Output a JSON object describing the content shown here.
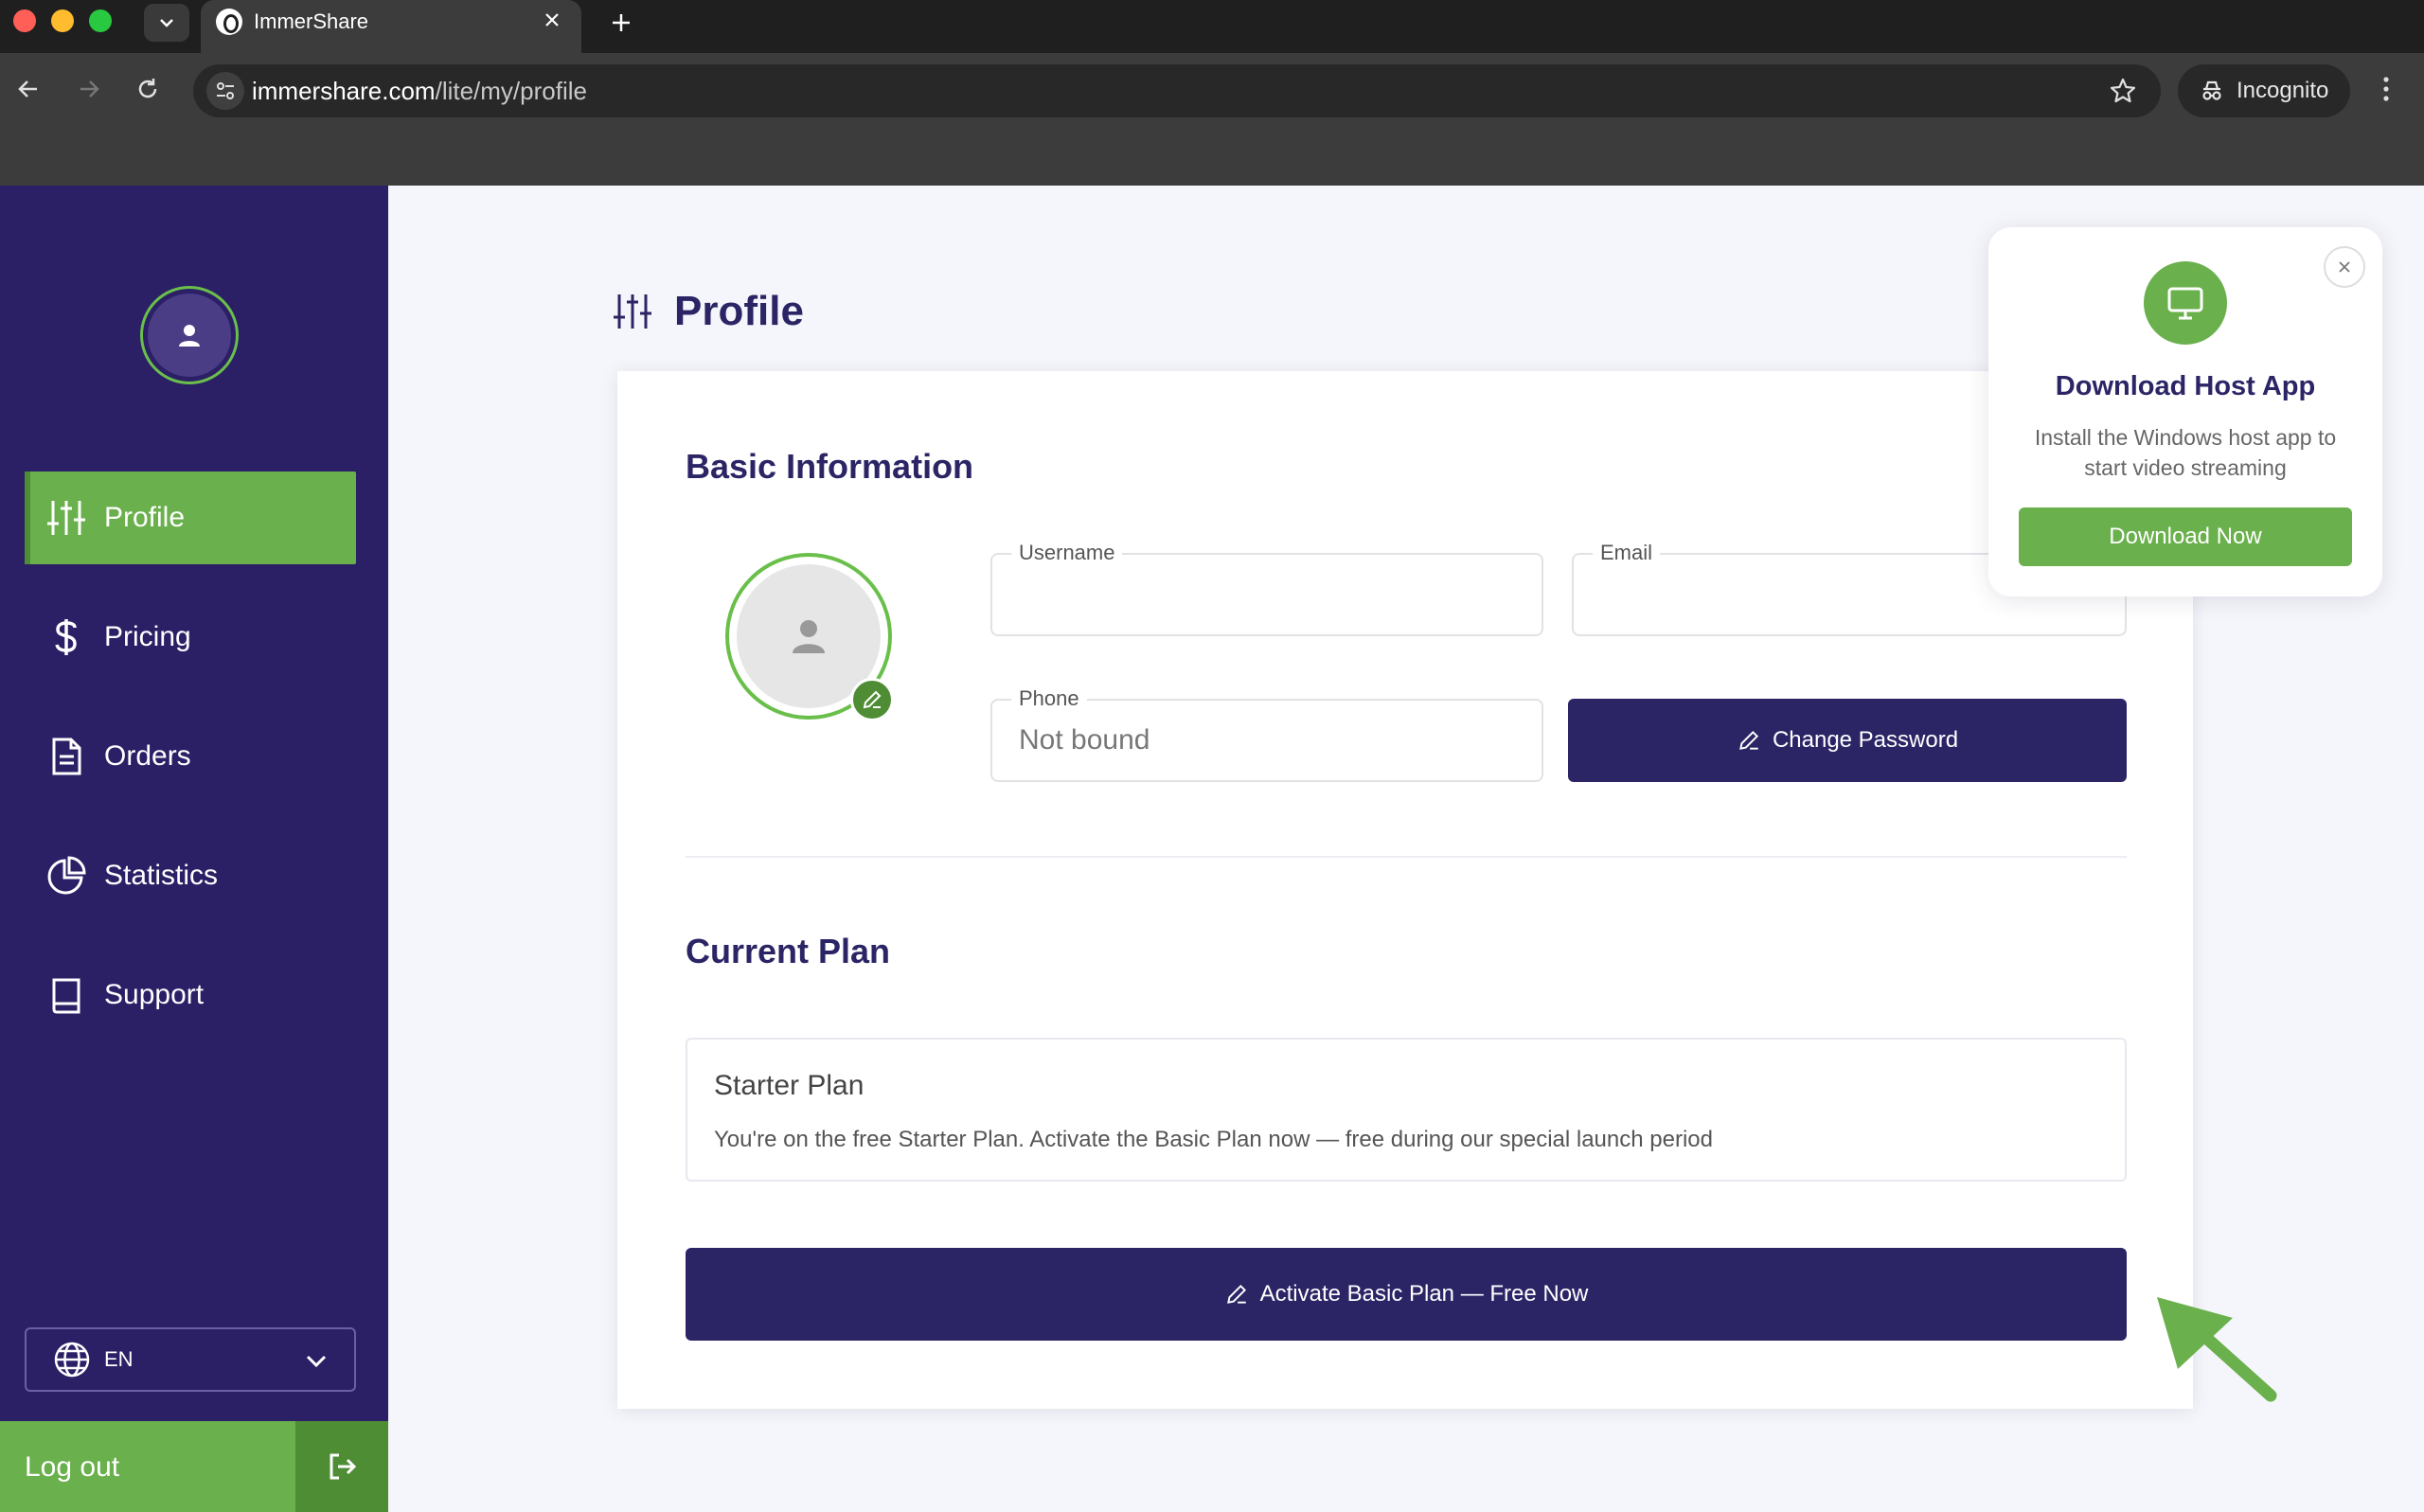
{
  "browser": {
    "tab_title": "ImmerShare",
    "url_host": "immershare.com",
    "url_path": "/lite/my/profile",
    "incognito_label": "Incognito"
  },
  "sidebar": {
    "items": [
      {
        "label": "Profile",
        "icon": "sliders-icon",
        "active": true
      },
      {
        "label": "Pricing",
        "icon": "dollar-icon",
        "active": false
      },
      {
        "label": "Orders",
        "icon": "document-icon",
        "active": false
      },
      {
        "label": "Statistics",
        "icon": "pie-chart-icon",
        "active": false
      },
      {
        "label": "Support",
        "icon": "book-icon",
        "active": false
      }
    ],
    "language": "EN",
    "logout_label": "Log out"
  },
  "main": {
    "page_title": "Profile",
    "basic_info_title": "Basic Information",
    "username": {
      "label": "Username",
      "value": ""
    },
    "email": {
      "label": "Email",
      "value": ""
    },
    "phone": {
      "label": "Phone",
      "placeholder": "Not bound"
    },
    "change_password_label": "Change Password",
    "current_plan_title": "Current Plan",
    "plan_name": "Starter Plan",
    "plan_description": "You're on the free Starter Plan. Activate the Basic Plan now — free during our special launch period",
    "activate_label": "Activate Basic Plan — Free Now"
  },
  "popup": {
    "title": "Download Host App",
    "description": "Install the Windows host app to start video streaming",
    "button_label": "Download Now"
  },
  "colors": {
    "sidebar_bg": "#2b1f66",
    "accent_green": "#6ab04c",
    "primary_dark": "#2b2566"
  }
}
